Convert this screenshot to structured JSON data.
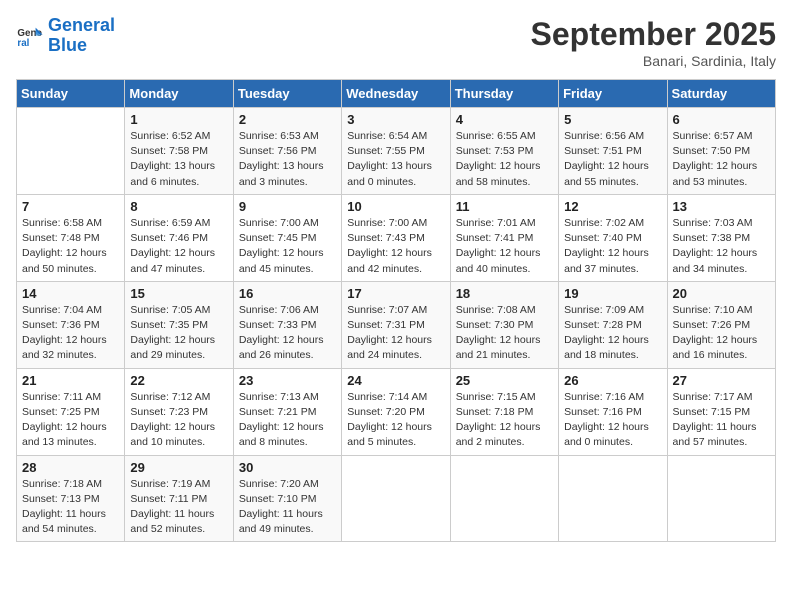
{
  "logo": {
    "line1": "General",
    "line2": "Blue"
  },
  "title": "September 2025",
  "subtitle": "Banari, Sardinia, Italy",
  "weekdays": [
    "Sunday",
    "Monday",
    "Tuesday",
    "Wednesday",
    "Thursday",
    "Friday",
    "Saturday"
  ],
  "weeks": [
    [
      {
        "day": "",
        "info": ""
      },
      {
        "day": "1",
        "info": "Sunrise: 6:52 AM\nSunset: 7:58 PM\nDaylight: 13 hours\nand 6 minutes."
      },
      {
        "day": "2",
        "info": "Sunrise: 6:53 AM\nSunset: 7:56 PM\nDaylight: 13 hours\nand 3 minutes."
      },
      {
        "day": "3",
        "info": "Sunrise: 6:54 AM\nSunset: 7:55 PM\nDaylight: 13 hours\nand 0 minutes."
      },
      {
        "day": "4",
        "info": "Sunrise: 6:55 AM\nSunset: 7:53 PM\nDaylight: 12 hours\nand 58 minutes."
      },
      {
        "day": "5",
        "info": "Sunrise: 6:56 AM\nSunset: 7:51 PM\nDaylight: 12 hours\nand 55 minutes."
      },
      {
        "day": "6",
        "info": "Sunrise: 6:57 AM\nSunset: 7:50 PM\nDaylight: 12 hours\nand 53 minutes."
      }
    ],
    [
      {
        "day": "7",
        "info": "Sunrise: 6:58 AM\nSunset: 7:48 PM\nDaylight: 12 hours\nand 50 minutes."
      },
      {
        "day": "8",
        "info": "Sunrise: 6:59 AM\nSunset: 7:46 PM\nDaylight: 12 hours\nand 47 minutes."
      },
      {
        "day": "9",
        "info": "Sunrise: 7:00 AM\nSunset: 7:45 PM\nDaylight: 12 hours\nand 45 minutes."
      },
      {
        "day": "10",
        "info": "Sunrise: 7:00 AM\nSunset: 7:43 PM\nDaylight: 12 hours\nand 42 minutes."
      },
      {
        "day": "11",
        "info": "Sunrise: 7:01 AM\nSunset: 7:41 PM\nDaylight: 12 hours\nand 40 minutes."
      },
      {
        "day": "12",
        "info": "Sunrise: 7:02 AM\nSunset: 7:40 PM\nDaylight: 12 hours\nand 37 minutes."
      },
      {
        "day": "13",
        "info": "Sunrise: 7:03 AM\nSunset: 7:38 PM\nDaylight: 12 hours\nand 34 minutes."
      }
    ],
    [
      {
        "day": "14",
        "info": "Sunrise: 7:04 AM\nSunset: 7:36 PM\nDaylight: 12 hours\nand 32 minutes."
      },
      {
        "day": "15",
        "info": "Sunrise: 7:05 AM\nSunset: 7:35 PM\nDaylight: 12 hours\nand 29 minutes."
      },
      {
        "day": "16",
        "info": "Sunrise: 7:06 AM\nSunset: 7:33 PM\nDaylight: 12 hours\nand 26 minutes."
      },
      {
        "day": "17",
        "info": "Sunrise: 7:07 AM\nSunset: 7:31 PM\nDaylight: 12 hours\nand 24 minutes."
      },
      {
        "day": "18",
        "info": "Sunrise: 7:08 AM\nSunset: 7:30 PM\nDaylight: 12 hours\nand 21 minutes."
      },
      {
        "day": "19",
        "info": "Sunrise: 7:09 AM\nSunset: 7:28 PM\nDaylight: 12 hours\nand 18 minutes."
      },
      {
        "day": "20",
        "info": "Sunrise: 7:10 AM\nSunset: 7:26 PM\nDaylight: 12 hours\nand 16 minutes."
      }
    ],
    [
      {
        "day": "21",
        "info": "Sunrise: 7:11 AM\nSunset: 7:25 PM\nDaylight: 12 hours\nand 13 minutes."
      },
      {
        "day": "22",
        "info": "Sunrise: 7:12 AM\nSunset: 7:23 PM\nDaylight: 12 hours\nand 10 minutes."
      },
      {
        "day": "23",
        "info": "Sunrise: 7:13 AM\nSunset: 7:21 PM\nDaylight: 12 hours\nand 8 minutes."
      },
      {
        "day": "24",
        "info": "Sunrise: 7:14 AM\nSunset: 7:20 PM\nDaylight: 12 hours\nand 5 minutes."
      },
      {
        "day": "25",
        "info": "Sunrise: 7:15 AM\nSunset: 7:18 PM\nDaylight: 12 hours\nand 2 minutes."
      },
      {
        "day": "26",
        "info": "Sunrise: 7:16 AM\nSunset: 7:16 PM\nDaylight: 12 hours\nand 0 minutes."
      },
      {
        "day": "27",
        "info": "Sunrise: 7:17 AM\nSunset: 7:15 PM\nDaylight: 11 hours\nand 57 minutes."
      }
    ],
    [
      {
        "day": "28",
        "info": "Sunrise: 7:18 AM\nSunset: 7:13 PM\nDaylight: 11 hours\nand 54 minutes."
      },
      {
        "day": "29",
        "info": "Sunrise: 7:19 AM\nSunset: 7:11 PM\nDaylight: 11 hours\nand 52 minutes."
      },
      {
        "day": "30",
        "info": "Sunrise: 7:20 AM\nSunset: 7:10 PM\nDaylight: 11 hours\nand 49 minutes."
      },
      {
        "day": "",
        "info": ""
      },
      {
        "day": "",
        "info": ""
      },
      {
        "day": "",
        "info": ""
      },
      {
        "day": "",
        "info": ""
      }
    ]
  ]
}
